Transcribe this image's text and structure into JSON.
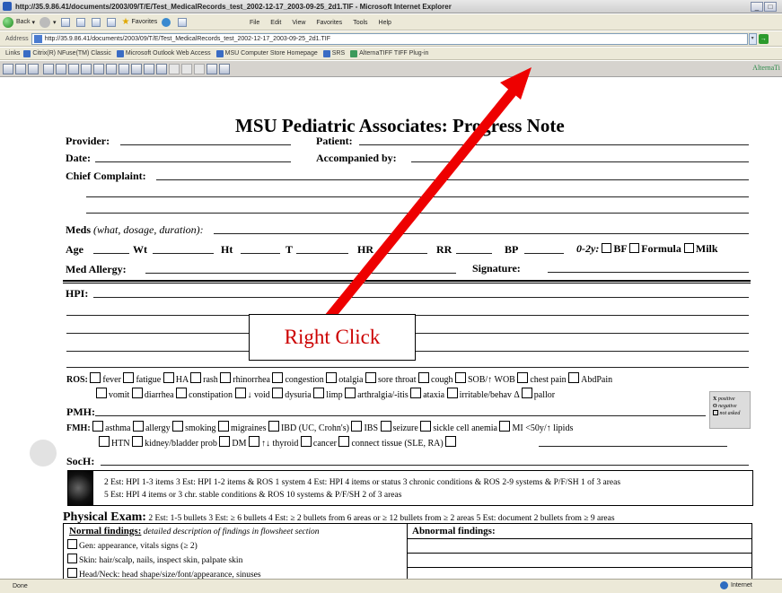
{
  "window": {
    "title": "http://35.9.86.41/documents/2003/09/T/E/Test_MedicalRecords_test_2002-12-17_2003-09-25_2d1.TIF - Microsoft Internet Explorer"
  },
  "toolbar": {
    "back": "Back",
    "favorites": "Favorites",
    "menus": [
      "File",
      "Edit",
      "View",
      "Favorites",
      "Tools",
      "Help"
    ]
  },
  "address": {
    "label": "Address",
    "url": "http://35.9.86.41/documents/2003/09/T/E/Test_MedicalRecords_test_2002-12-17_2003-09-25_2d1.TIF"
  },
  "links": {
    "label": "Links",
    "items": [
      "Citrix(R) NFuse(TM) Classic",
      "Microsoft Outlook Web Access",
      "MSU Computer Store Homepage",
      "SRS",
      "AlternaTIFF TIFF Plug-in"
    ]
  },
  "plugin": {
    "brand": "AlternaTi"
  },
  "form": {
    "title": "MSU Pediatric Associates: Progress Note",
    "provider": "Provider:",
    "patient": "Patient:",
    "date": "Date:",
    "accompanied": "Accompanied by:",
    "chief": "Chief Complaint:",
    "meds": "Meds",
    "meds_note": "(what, dosage, duration):",
    "vitals": {
      "age": "Age",
      "wt": "Wt",
      "ht": "Ht",
      "t": "T",
      "hr": "HR",
      "rr": "RR",
      "bp": "BP",
      "age_range": "0-2y:",
      "bf": "BF",
      "formula": "Formula",
      "milk": "Milk"
    },
    "allergy": "Med Allergy:",
    "signature": "Signature:",
    "hpi": "HPI:",
    "ros_label": "ROS:",
    "ros_row1": [
      "fever",
      "fatigue",
      "HA",
      "rash",
      "rhinorrhea",
      "congestion",
      "otalgia",
      "sore throat",
      "cough",
      "SOB/↑ WOB",
      "chest pain",
      "AbdPain"
    ],
    "ros_row2": [
      "vomit",
      "diarrhea",
      "constipation",
      "↓ void",
      "dysuria",
      "limp",
      "arthralgia/-itis",
      "ataxia",
      "irritable/behav Δ",
      "pallor"
    ],
    "pmh": "PMH:",
    "fmh": "FMH:",
    "fmh_row1": [
      "asthma",
      "allergy",
      "smoking",
      "migraines",
      "IBD (UC, Crohn's)",
      "IBS",
      "seizure",
      "sickle cell anemia",
      "MI <50y/↑ lipids"
    ],
    "fmh_row2": [
      "HTN",
      "kidney/bladder prob",
      "DM",
      "↑↓ thyroid",
      "cancer",
      "connect tissue (SLE, RA)"
    ],
    "soch": "SocH:",
    "legend": {
      "x": "X",
      "positive": "positive",
      "o": "O",
      "negative": "negative",
      "not_asked": "not asked"
    },
    "est_line1": "2 Est: HPI 1-3 items   3 Est: HPI 1-2 items & ROS 1 system   4 Est: HPI 4 items or status 3 chronic conditions & ROS 2-9 systems & P/F/SH 1 of 3 areas",
    "est_line2": "5 Est:  HPI 4 items or 3 chr. stable conditions & ROS 10 systems & P/F/SH 2 of 3 areas",
    "pe_title": "Physical Exam:",
    "pe_rest": "2 Est: 1-5 bullets   3 Est: ≥ 6 bullets   4 Est: ≥ 2 bullets from 6 areas or ≥ 12 bullets from ≥ 2 areas   5 Est: document 2 bullets from  ≥ 9 areas",
    "normal": "Normal findings:",
    "normal_note": "detailed description of findings in flowsheet section",
    "abnormal": "Abnormal findings:",
    "exam_rows": [
      "Gen: appearance, vitals signs (≥ 2)",
      "Skin: hair/scalp, nails, inspect skin, palpate skin",
      "Head/Neck: head shape/size/font/appearance, sinuses"
    ]
  },
  "callout": {
    "text": "Right Click"
  },
  "status": {
    "done": "Done",
    "zone": "Internet"
  }
}
